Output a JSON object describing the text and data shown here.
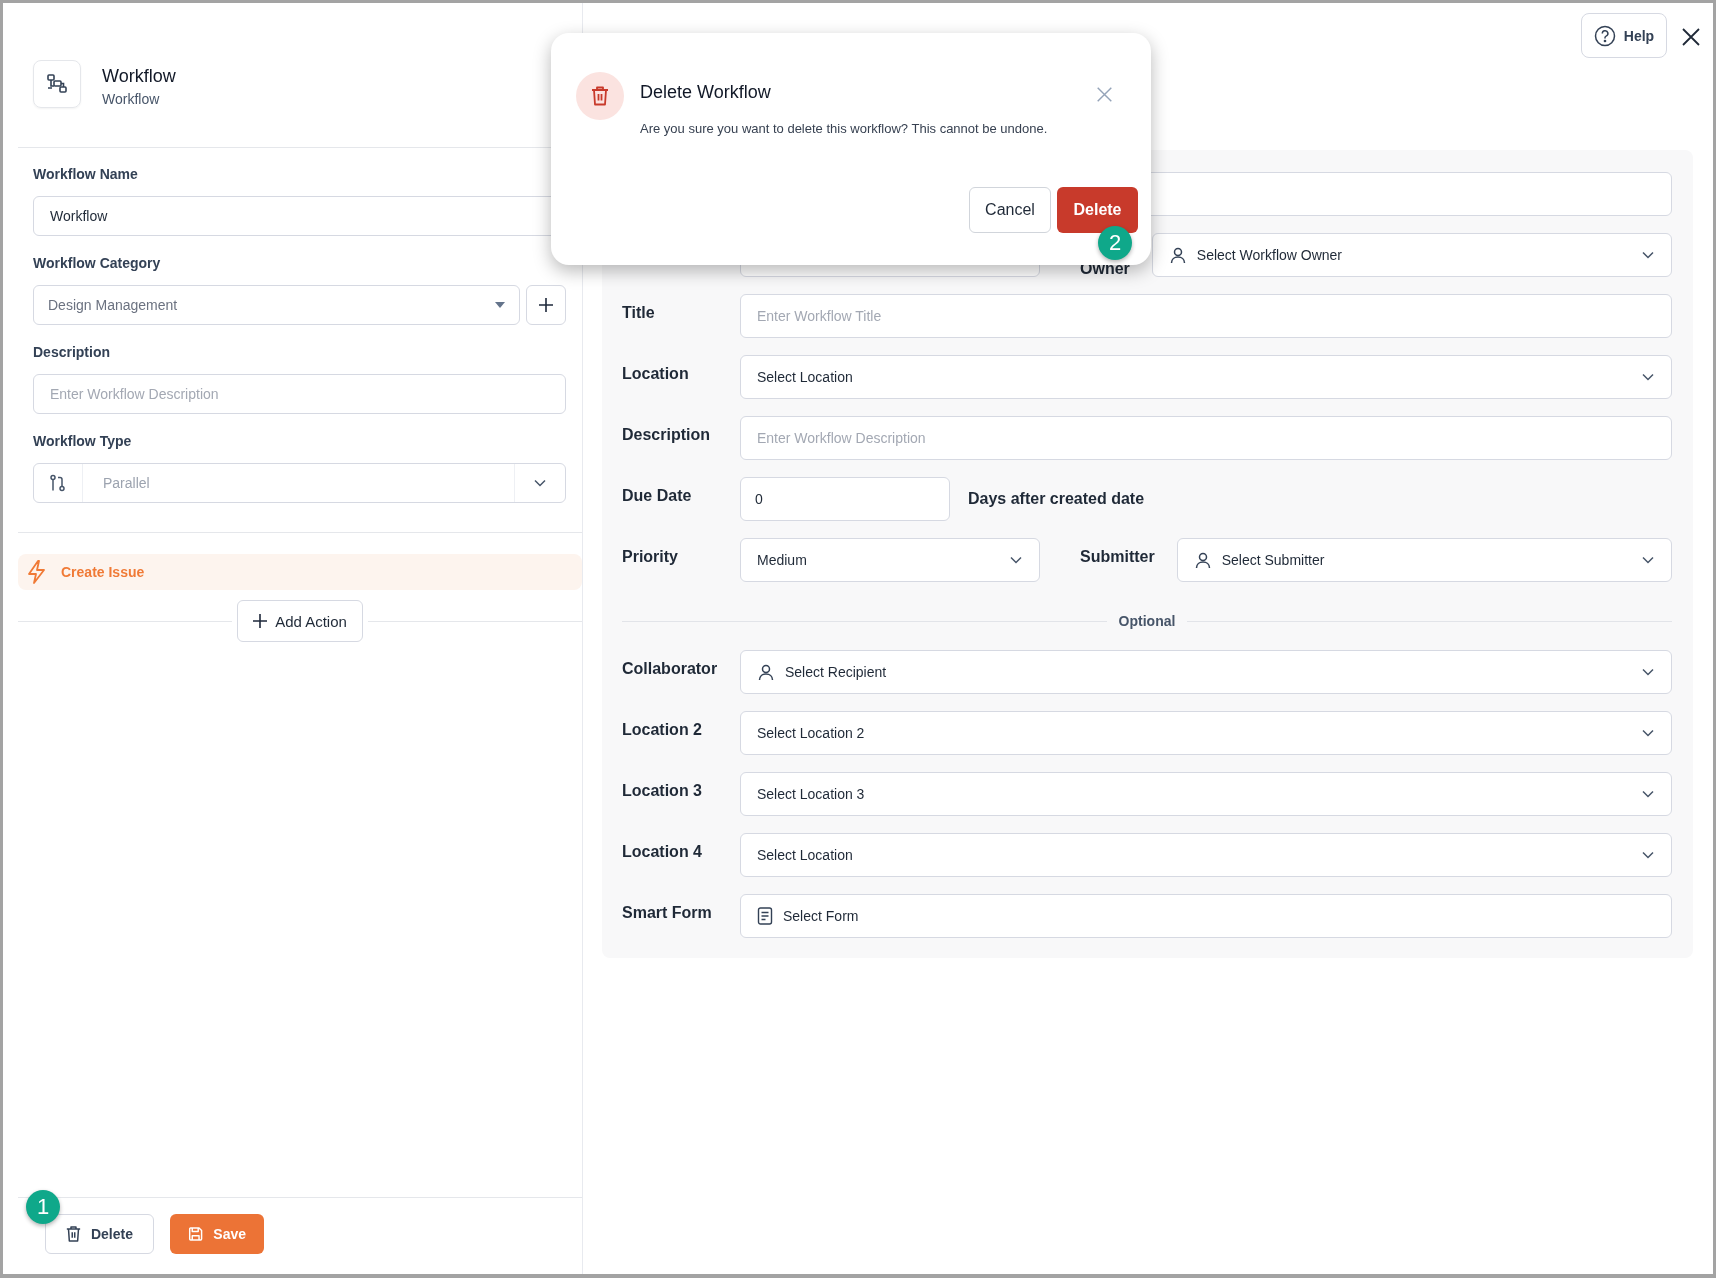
{
  "header": {
    "title": "Workflow",
    "subtitle": "Workflow"
  },
  "help_button": {
    "label": "Help"
  },
  "left_form": [
    {
      "label": "Workflow Name",
      "kind": "text",
      "value": "Workflow"
    },
    {
      "label": "Workflow Category",
      "kind": "category-select",
      "value": "Design Management"
    },
    {
      "label": "Description",
      "kind": "text",
      "placeholder": "Enter Workflow Description"
    },
    {
      "label": "Workflow Type",
      "kind": "type-select",
      "value": "Parallel"
    }
  ],
  "actions": [
    {
      "label": "Create Issue",
      "selected": true
    }
  ],
  "add_action": {
    "label": "Add Action"
  },
  "footer_buttons": [
    {
      "label": "Delete",
      "kind": "delete",
      "marker": "1"
    },
    {
      "label": "Save",
      "kind": "save"
    }
  ],
  "form_rows": [
    {
      "kind": "row",
      "items": [
        {
          "kind": "text"
        }
      ]
    },
    {
      "kind": "row",
      "items": [
        {
          "kind": "text"
        },
        {
          "kind": "label",
          "text": "Owner"
        },
        {
          "kind": "user-select",
          "value": "Select Workflow Owner"
        }
      ]
    },
    {
      "kind": "row",
      "items": [
        {
          "kind": "label",
          "text": "Title"
        },
        {
          "kind": "text",
          "placeholder": "Enter Workflow Title"
        }
      ]
    },
    {
      "kind": "row",
      "items": [
        {
          "kind": "label",
          "text": "Location"
        },
        {
          "kind": "select",
          "value": "Select Location"
        }
      ]
    },
    {
      "kind": "row",
      "items": [
        {
          "kind": "label",
          "text": "Description"
        },
        {
          "kind": "text",
          "placeholder": "Enter Workflow Description"
        }
      ]
    },
    {
      "kind": "row",
      "items": [
        {
          "kind": "label",
          "text": "Due Date"
        },
        {
          "kind": "number",
          "value": "0"
        },
        {
          "kind": "note",
          "text": "Days after created date"
        }
      ]
    },
    {
      "kind": "row",
      "items": [
        {
          "kind": "label",
          "text": "Priority"
        },
        {
          "kind": "select",
          "value": "Medium"
        },
        {
          "kind": "label",
          "text": "Submitter"
        },
        {
          "kind": "user-select",
          "value": "Select Submitter"
        }
      ]
    },
    {
      "kind": "divider",
      "text": "Optional"
    },
    {
      "kind": "row",
      "items": [
        {
          "kind": "label",
          "text": "Collaborator"
        },
        {
          "kind": "user-select",
          "value": "Select Recipient"
        }
      ]
    },
    {
      "kind": "row",
      "items": [
        {
          "kind": "label",
          "text": "Location 2"
        },
        {
          "kind": "select",
          "value": "Select Location 2"
        }
      ]
    },
    {
      "kind": "row",
      "items": [
        {
          "kind": "label",
          "text": "Location 3"
        },
        {
          "kind": "select",
          "value": "Select Location 3"
        }
      ]
    },
    {
      "kind": "row",
      "items": [
        {
          "kind": "label",
          "text": "Location 4"
        },
        {
          "kind": "select",
          "value": "Select Location"
        }
      ]
    },
    {
      "kind": "row",
      "items": [
        {
          "kind": "label",
          "text": "Smart Form"
        },
        {
          "kind": "form-select",
          "value": "Select Form"
        }
      ]
    }
  ],
  "dialog": {
    "title": "Delete Workflow",
    "message": "Are you sure you want to delete this workflow? This cannot be undone.",
    "buttons": [
      {
        "label": "Cancel",
        "kind": "secondary"
      },
      {
        "label": "Delete",
        "kind": "danger",
        "marker": "2"
      }
    ]
  }
}
